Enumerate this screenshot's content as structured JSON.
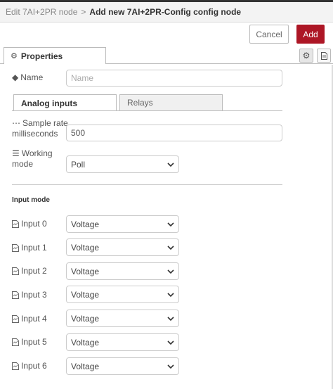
{
  "header": {
    "breadcrumb_parent": "Edit 7AI+2PR node",
    "separator": ">",
    "breadcrumb_current": "Add new 7AI+2PR-Config config node"
  },
  "actions": {
    "cancel_label": "Cancel",
    "add_label": "Add"
  },
  "tabs": {
    "properties_label": "Properties"
  },
  "form": {
    "name_label": "Name",
    "name_placeholder": "Name",
    "name_value": ""
  },
  "subtabs": {
    "analog_label": "Analog inputs",
    "relays_label": "Relays"
  },
  "analog": {
    "sample_rate_label_1": "Sample rate",
    "sample_rate_label_2": "milliseconds",
    "sample_rate_value": "500",
    "working_mode_label_1": "Working",
    "working_mode_label_2": "mode",
    "working_mode_value": "Poll",
    "input_mode_title": "Input mode",
    "inputs": [
      {
        "label": "Input 0",
        "value": "Voltage"
      },
      {
        "label": "Input 1",
        "value": "Voltage"
      },
      {
        "label": "Input 2",
        "value": "Voltage"
      },
      {
        "label": "Input 3",
        "value": "Voltage"
      },
      {
        "label": "Input 4",
        "value": "Voltage"
      },
      {
        "label": "Input 5",
        "value": "Voltage"
      },
      {
        "label": "Input 6",
        "value": "Voltage"
      }
    ]
  },
  "colors": {
    "accent": "#ad1625",
    "border": "#cccccc",
    "text": "#555555"
  }
}
